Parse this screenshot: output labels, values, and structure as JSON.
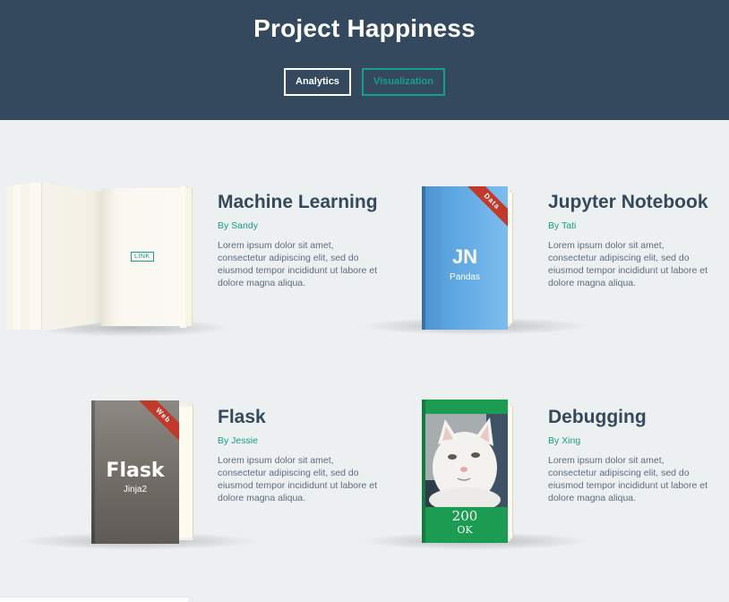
{
  "header": {
    "title": "Project Happiness",
    "filters": [
      {
        "label": "Analytics",
        "active": true
      },
      {
        "label": "Visualization",
        "active": false
      }
    ]
  },
  "cards": [
    {
      "title": "Machine Learning",
      "author": "By Sandy",
      "description": "Lorem ipsum dolor sit amet, consectetur adipiscing elit, sed do eiusmod tempor incididunt ut labore et dolore magna aliqua.",
      "cover": {
        "style": "open-book",
        "link_label": "LINK"
      }
    },
    {
      "title": "Jupyter Notebook",
      "author": "By Tati",
      "description": "Lorem ipsum dolor sit amet, consectetur adipiscing elit, sed do eiusmod tempor incididunt ut labore et dolore magna aliqua.",
      "cover": {
        "style": "blue",
        "title": "JN",
        "subtitle": "Pandas",
        "ribbon": "Data",
        "color": "#5aa4df"
      }
    },
    {
      "title": "Flask",
      "author": "By Jessie",
      "description": "Lorem ipsum dolor sit amet, consectetur adipiscing elit, sed do eiusmod tempor incididunt ut labore et dolore magna aliqua.",
      "cover": {
        "style": "gray",
        "title": "Flask",
        "subtitle": "Jinja2",
        "ribbon": "Web",
        "color": "#7f7a74"
      }
    },
    {
      "title": "Debugging",
      "author": "By Xing",
      "description": "Lorem ipsum dolor sit amet, consectetur adipiscing elit, sed do eiusmod tempor incididunt ut labore et dolore magna aliqua.",
      "cover": {
        "style": "photo",
        "image": "white-cat-photo",
        "code": "200",
        "status": "OK",
        "color": "#1c9b52"
      }
    }
  ]
}
